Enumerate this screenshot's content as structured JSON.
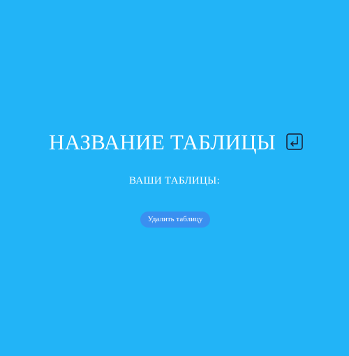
{
  "header": {
    "table_title": "НАЗВАНИЕ ТАБЛИЦЫ",
    "enter_icon": "return-enter-icon"
  },
  "main": {
    "your_tables_label": "ВАШИ ТАБЛИЦЫ:",
    "delete_table_label": "Удалить таблицу"
  },
  "colors": {
    "background": "#22b4f7",
    "button": "#3a8ff0",
    "text": "#ffffff",
    "icon_stroke": "#1a1a2e"
  }
}
